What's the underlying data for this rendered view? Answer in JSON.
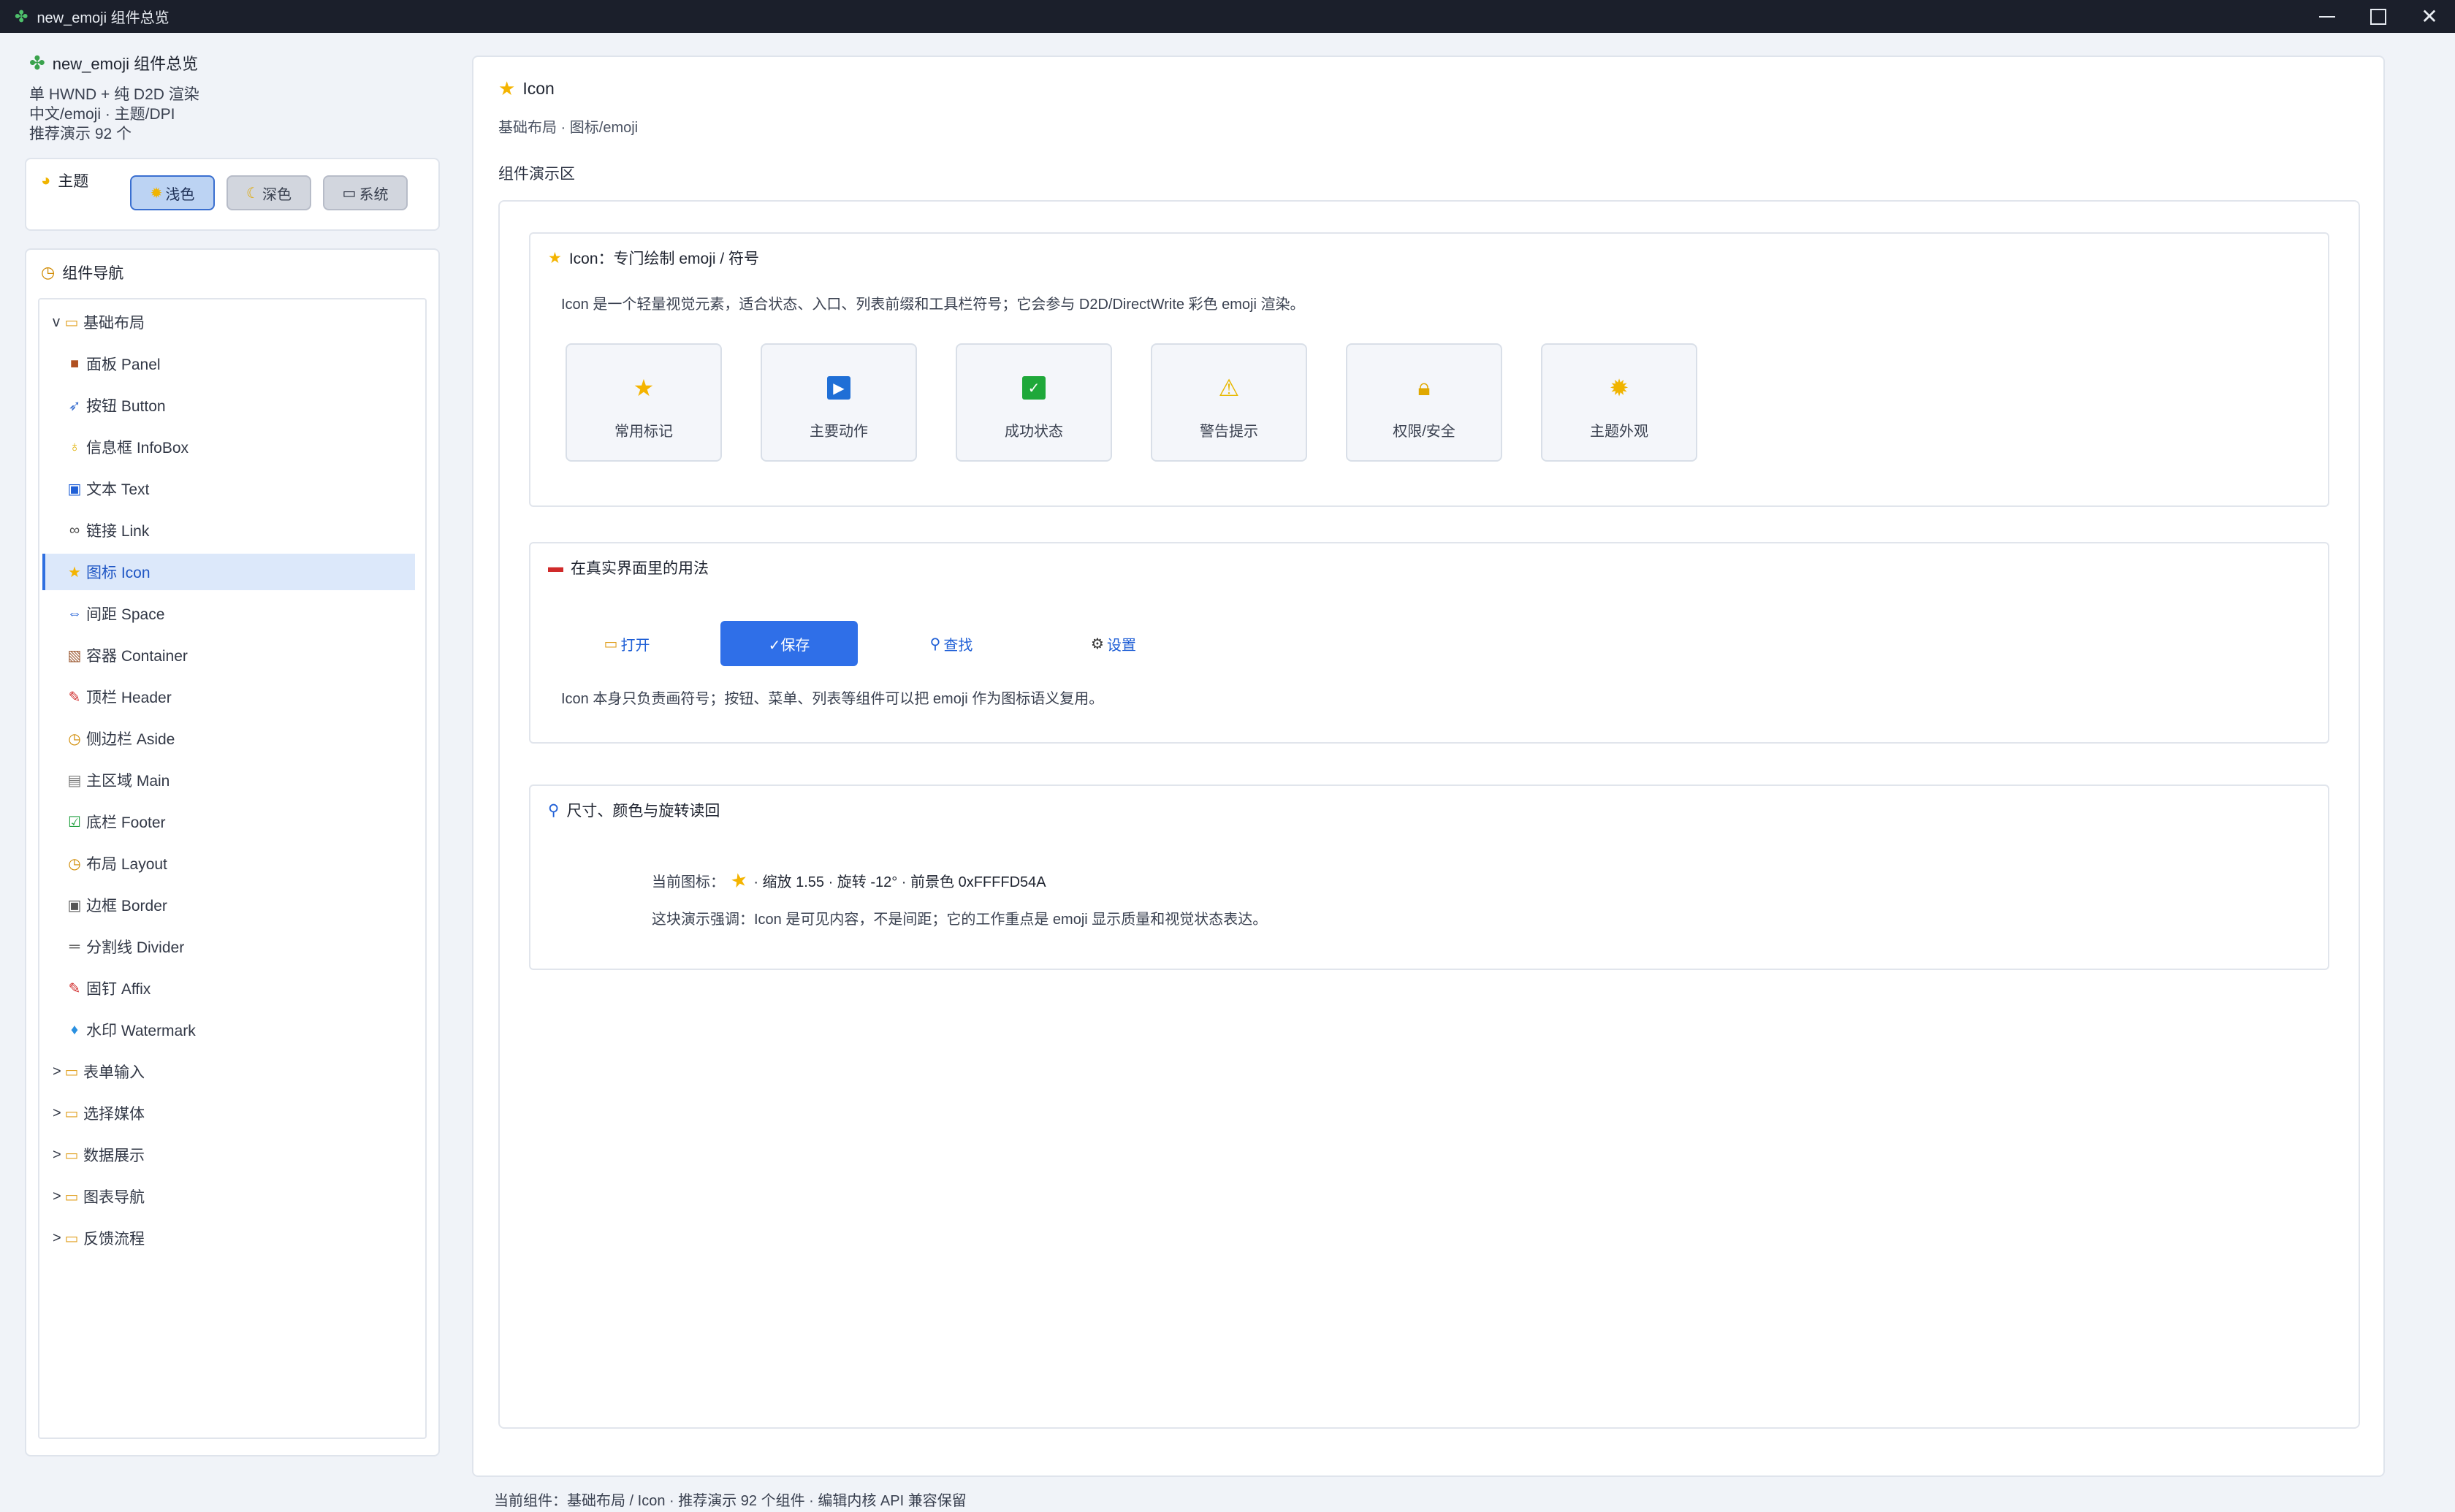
{
  "window": {
    "title": "new_emoji 组件总览",
    "app_icon": "clover-icon"
  },
  "sidebar": {
    "app_title": "new_emoji 组件总览",
    "meta": [
      "单 HWND + 纯 D2D 渲染",
      "中文/emoji · 主题/DPI",
      "推荐演示 92 个"
    ],
    "theme": {
      "label": "主题",
      "options": [
        {
          "label": "浅色",
          "icon": "sun-icon",
          "active": true
        },
        {
          "label": "深色",
          "icon": "moon-icon",
          "active": false
        },
        {
          "label": "系统",
          "icon": "laptop-icon",
          "active": false
        }
      ]
    },
    "nav": {
      "label": "组件导航",
      "groups": [
        {
          "caret": "v",
          "label": "基础布局",
          "expanded": true,
          "children": [
            {
              "label": "面板 Panel",
              "icon": "panel-icon"
            },
            {
              "label": "按钮 Button",
              "icon": "rocket-icon"
            },
            {
              "label": "信息框 InfoBox",
              "icon": "bulb-icon"
            },
            {
              "label": "文本 Text",
              "icon": "text-icon"
            },
            {
              "label": "链接 Link",
              "icon": "link-icon"
            },
            {
              "label": "图标 Icon",
              "icon": "star-icon",
              "selected": true
            },
            {
              "label": "间距 Space",
              "icon": "space-icon"
            },
            {
              "label": "容器 Container",
              "icon": "box-icon"
            },
            {
              "label": "顶栏 Header",
              "icon": "pin-icon"
            },
            {
              "label": "侧边栏 Aside",
              "icon": "compass-icon"
            },
            {
              "label": "主区域 Main",
              "icon": "page-icon"
            },
            {
              "label": "底栏 Footer",
              "icon": "check-icon"
            },
            {
              "label": "布局 Layout",
              "icon": "compass-icon"
            },
            {
              "label": "边框 Border",
              "icon": "border-icon"
            },
            {
              "label": "分割线 Divider",
              "icon": "divider-icon"
            },
            {
              "label": "固钉 Affix",
              "icon": "pin-icon"
            },
            {
              "label": "水印 Watermark",
              "icon": "droplet-icon"
            }
          ]
        },
        {
          "caret": ">",
          "label": "表单输入"
        },
        {
          "caret": ">",
          "label": "选择媒体"
        },
        {
          "caret": ">",
          "label": "数据展示"
        },
        {
          "caret": ">",
          "label": "图表导航"
        },
        {
          "caret": ">",
          "label": "反馈流程"
        }
      ]
    }
  },
  "main": {
    "title": "Icon",
    "breadcrumb": "基础布局 · 图标/emoji",
    "section": "组件演示区",
    "card1": {
      "title": "Icon：专门绘制 emoji / 符号",
      "desc": "Icon 是一个轻量视觉元素，适合状态、入口、列表前缀和工具栏符号；它会参与 D2D/DirectWrite 彩色 emoji 渲染。",
      "tiles": [
        {
          "label": "常用标记",
          "icon": "star-icon"
        },
        {
          "label": "主要动作",
          "icon": "play-icon"
        },
        {
          "label": "成功状态",
          "icon": "check-icon"
        },
        {
          "label": "警告提示",
          "icon": "warning-icon"
        },
        {
          "label": "权限/安全",
          "icon": "lock-icon"
        },
        {
          "label": "主题外观",
          "icon": "sun-icon"
        }
      ]
    },
    "card2": {
      "title": "在真实界面里的用法",
      "actions": [
        {
          "label": "打开",
          "icon": "folder-icon",
          "primary": false
        },
        {
          "label": "✓保存",
          "icon": "",
          "primary": true
        },
        {
          "label": "查找",
          "icon": "search-icon",
          "primary": false
        },
        {
          "label": "设置",
          "icon": "gear-icon",
          "primary": false
        }
      ],
      "desc": "Icon 本身只负责画符号；按钮、菜单、列表等组件可以把 emoji 作为图标语义复用。"
    },
    "card3": {
      "title": "尺寸、颜色与旋转读回",
      "current_prefix": "当前图标：",
      "current_suffix": "· 缩放 1.55 · 旋转 -12° · 前景色 0xFFFFD54A",
      "desc": "这块演示强调：Icon 是可见内容，不是间距；它的工作重点是 emoji 显示质量和视觉状态表达。"
    }
  },
  "status": "当前组件：基础布局 / Icon · 推荐演示 92 个组件 · 编辑内核 API 兼容保留",
  "colors": {
    "accent": "#2f6fe8",
    "titlebar": "#1b1f2b",
    "selected_bg": "#dce8fa"
  }
}
